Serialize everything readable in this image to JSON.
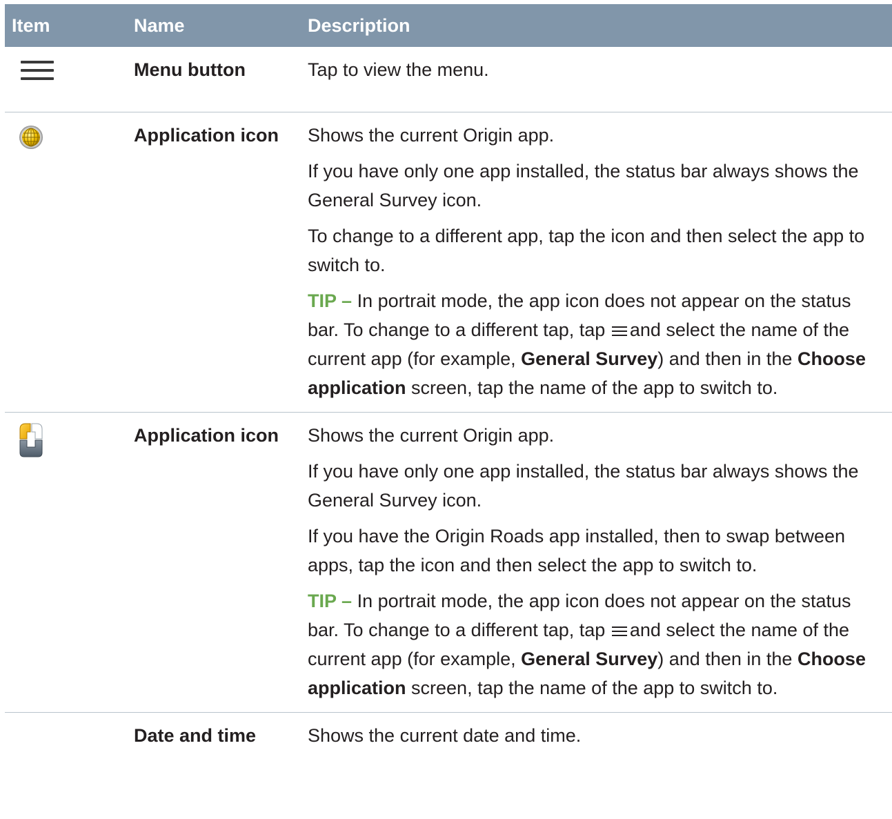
{
  "table": {
    "headers": {
      "item": "Item",
      "name": "Name",
      "description": "Description"
    },
    "rows": [
      {
        "icon": "hamburger-menu-icon",
        "name": "Menu button",
        "description": [
          "Tap to view the menu."
        ]
      },
      {
        "icon": "globe-app-icon",
        "name": "Application icon",
        "description": [
          "Shows the current Origin app.",
          "If you have only one app installed, the status bar always shows the General Survey icon.",
          "To change to a different app, tap the icon and then select the app to switch to."
        ],
        "tip": {
          "label": "TIP –",
          "text_1": "In portrait mode, the app icon does not appear on the status bar. To change to a different tap, tap",
          "text_2": "and select the name of the current app (for example,",
          "bold_1": "General Survey",
          "text_3": ") and then in the",
          "bold_2": "Choose application",
          "text_4": "screen, tap the name of the app to switch to."
        }
      },
      {
        "icon": "roads-app-icon",
        "name": "Application icon",
        "description": [
          "Shows the current Origin app.",
          "If you have only one app installed, the status bar always shows the General Survey icon.",
          "If you have the Origin Roads app installed, then to swap between apps, tap the icon and then select the app to switch to."
        ],
        "tip": {
          "label": "TIP –",
          "text_1": "In portrait mode, the app icon does not appear on the status bar. To change to a different tap, tap",
          "text_2": "and select the name of the current app (for example,",
          "bold_1": "General Survey",
          "text_3": ") and then in the",
          "bold_2": "Choose application",
          "text_4": "screen, tap the name of the app to switch to."
        }
      },
      {
        "icon": "",
        "name": "Date and time",
        "description": [
          "Shows the current date and time."
        ]
      }
    ]
  },
  "colors": {
    "header_bg": "#8196aa",
    "tip": "#6aa84f",
    "rule": "#b9c3cc"
  }
}
